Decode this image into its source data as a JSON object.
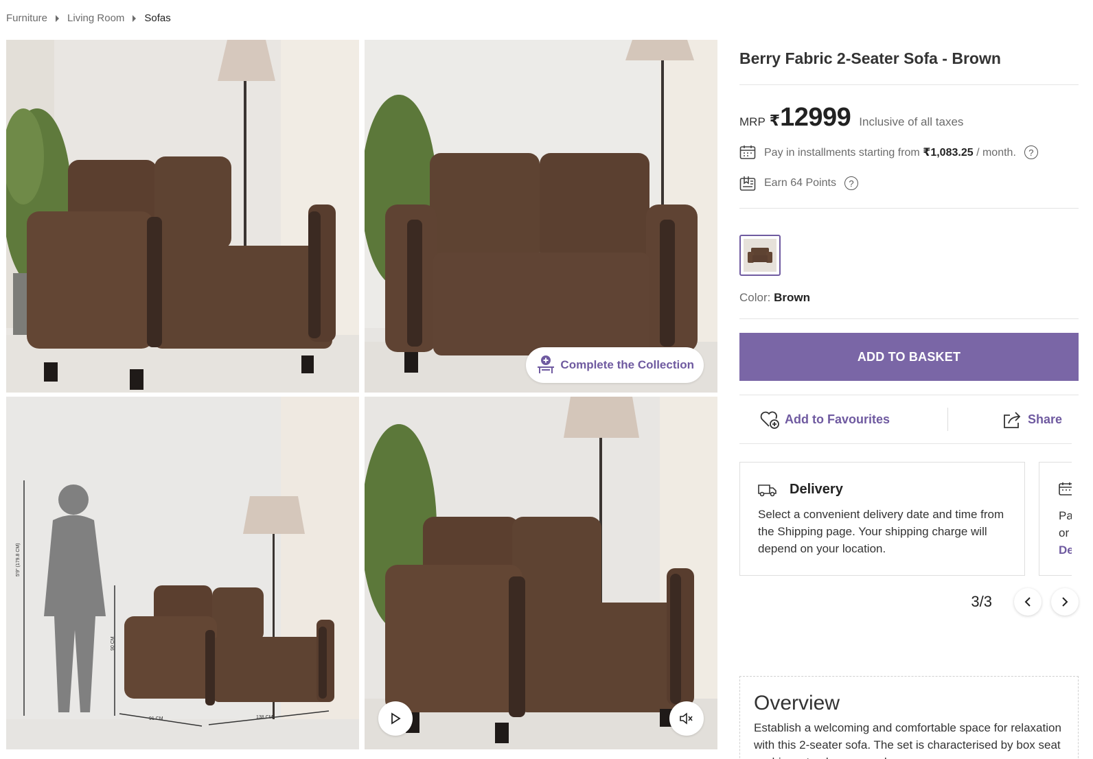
{
  "breadcrumb": {
    "items": [
      "Furniture",
      "Living Room"
    ],
    "current": "Sofas"
  },
  "gallery": {
    "collection_cta": "Complete the Collection",
    "dimension_labels": {
      "height_person": "5'9\" (179.8 CM)",
      "height_sofa": "90 CM",
      "depth": "91 CM",
      "width": "138 CM"
    }
  },
  "product": {
    "title": "Berry Fabric 2-Seater Sofa - Brown",
    "mrp_label": "MRP",
    "currency": "₹",
    "price": "12999",
    "tax_note": "Inclusive of all taxes",
    "installment": {
      "prefix": "Pay in installments starting from",
      "amount": "₹1,083.25",
      "suffix": "/ month."
    },
    "points": "Earn 64 Points",
    "color_label": "Color:",
    "color_value": "Brown",
    "add_to_basket": "ADD TO BASKET",
    "favourites": "Add to Favourites",
    "share": "Share"
  },
  "cards": {
    "delivery": {
      "title": "Delivery",
      "text": "Select a convenient delivery date and time from the Shipping page. Your shipping charge will depend on your location."
    },
    "partial": {
      "line1": "Pa",
      "line2": "or",
      "line3": "De"
    },
    "pager": "3/3"
  },
  "overview": {
    "title": "Overview",
    "text": "Establish a welcoming and comfortable space for relaxation with this 2-seater sofa. The set is characterised by box seat cushions, track arms, and"
  },
  "colors": {
    "accent": "#7a66a6",
    "accent_text": "#6f5aa0",
    "sofa": "#5e4332"
  }
}
